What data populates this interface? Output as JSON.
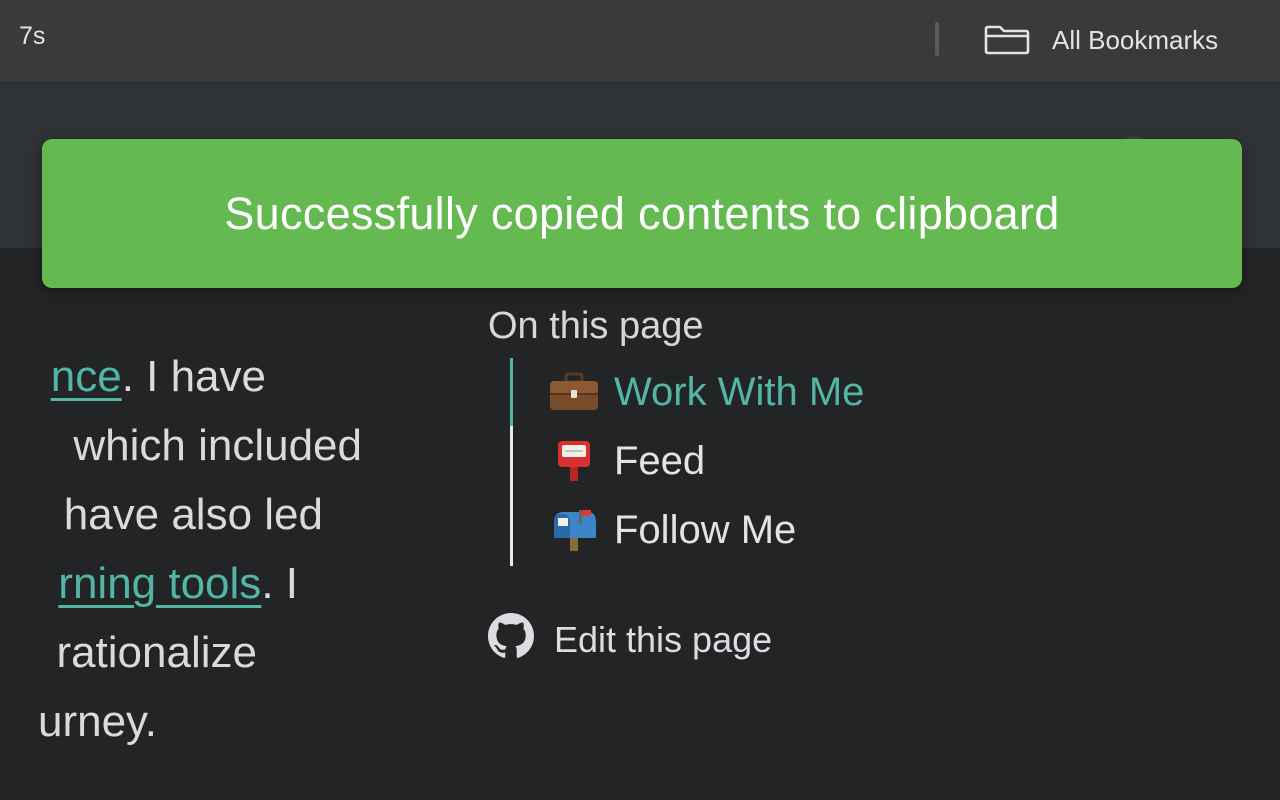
{
  "bookmarks_bar": {
    "left_item": "7s",
    "all_bookmarks_label": "All Bookmarks",
    "all_bookmarks_icon": "folder-icon"
  },
  "toast": {
    "message": "Successfully copied contents to clipboard",
    "color": "#64b950"
  },
  "content": {
    "lines": [
      {
        "parts": [
          {
            "text": "nce",
            "link": true
          },
          {
            "text": ". I have",
            "link": false
          }
        ]
      },
      {
        "parts": [
          {
            "text": "which included",
            "link": false
          }
        ]
      },
      {
        "parts": [
          {
            "text": "have also led",
            "link": false
          }
        ]
      },
      {
        "parts": [
          {
            "text": "rning tools",
            "link": true
          },
          {
            "text": ". I",
            "link": false
          }
        ]
      },
      {
        "parts": [
          {
            "text": "rationalize",
            "link": false
          }
        ]
      },
      {
        "parts": [
          {
            "text": "urney.",
            "link": false
          }
        ]
      }
    ]
  },
  "toc": {
    "title": "On this page",
    "items": [
      {
        "label": "Work With Me",
        "icon": "briefcase-icon",
        "emoji": "💼",
        "active": true
      },
      {
        "label": "Feed",
        "icon": "postbox-icon",
        "emoji": "📮",
        "active": false
      },
      {
        "label": "Follow Me",
        "icon": "mailbox-icon",
        "emoji": "📫",
        "active": false
      }
    ],
    "accent": "#52b6a6"
  },
  "edit_link": {
    "label": "Edit this page",
    "icon": "github-icon"
  }
}
